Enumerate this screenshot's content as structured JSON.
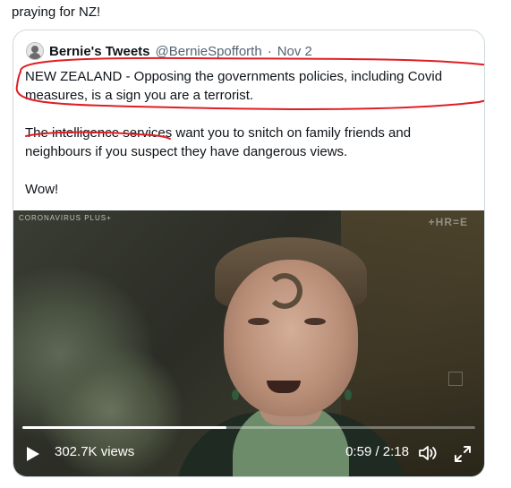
{
  "top_text": "praying for NZ!",
  "quote": {
    "author_name": "Bernie's Tweets",
    "author_handle": "@BernieSpofforth",
    "separator": "·",
    "date": "Nov 2",
    "paragraph1": "NEW ZEALAND - Opposing the governments policies, including Covid measures, is a sign you are a terrorist.",
    "paragraph2": "The intelligence services want you to snitch on family friends and neighbours if you suspect they have dangerous views.",
    "paragraph3": "Wow!"
  },
  "video": {
    "overlay_tag": "CORONAVIRUS PLUS+",
    "channel_logo": "+HR=E",
    "progress": 0.45,
    "views": "302.7K views",
    "time": "0:59 / 2:18",
    "icons": {
      "play": "play-icon",
      "volume": "volume-icon",
      "fullscreen": "fullscreen-icon"
    }
  },
  "colors": {
    "annotation_red": "#e01e25",
    "border": "#cfd9de",
    "secondary_text": "#536471"
  }
}
